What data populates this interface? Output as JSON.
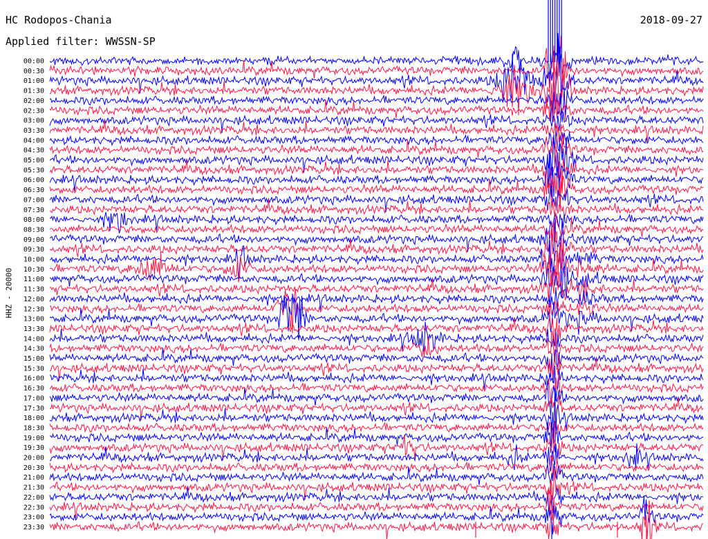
{
  "header": {
    "station": "HC Rodopos-Chania",
    "date": "2018-09-27",
    "filter": "Applied filter: WWSSN-SP"
  },
  "axis_label": "HHZ - 20000",
  "chart_data": {
    "type": "line",
    "title": "HC Rodopos-Chania",
    "subtitle": "Applied filter: WWSSN-SP",
    "ylabel": "HHZ - 20000",
    "row_labels": [
      "00:00",
      "00:30",
      "01:00",
      "01:30",
      "02:00",
      "02:30",
      "03:00",
      "03:30",
      "04:00",
      "04:30",
      "05:00",
      "05:30",
      "06:00",
      "06:30",
      "07:00",
      "07:30",
      "08:00",
      "08:30",
      "09:00",
      "09:30",
      "10:00",
      "10:30",
      "11:00",
      "11:30",
      "12:00",
      "12:30",
      "13:00",
      "13:30",
      "14:00",
      "14:30",
      "15:00",
      "15:30",
      "16:00",
      "16:30",
      "17:00",
      "17:30",
      "18:00",
      "18:30",
      "19:00",
      "19:30",
      "20:00",
      "20:30",
      "21:00",
      "21:30",
      "22:00",
      "22:30",
      "23:00",
      "23:30"
    ],
    "colors": [
      "#0000ff",
      "#ff1744"
    ]
  }
}
